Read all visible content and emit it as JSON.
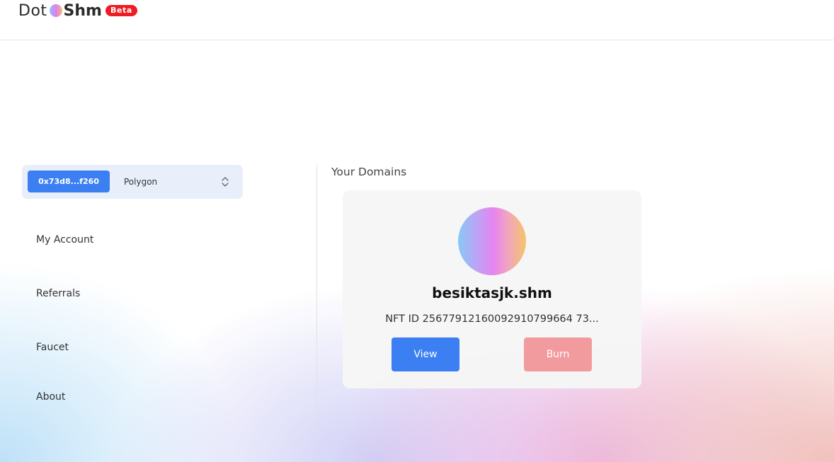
{
  "header": {
    "logo_dot": "Dot",
    "logo_shm": "Shm",
    "beta_badge": "Beta"
  },
  "account": {
    "address": "0x73d8...f260",
    "network": "Polygon"
  },
  "nav": {
    "items": [
      {
        "label": "My Account"
      },
      {
        "label": "Referrals"
      },
      {
        "label": "Faucet"
      },
      {
        "label": "About"
      }
    ]
  },
  "main": {
    "section_title": "Your Domains",
    "domains": [
      {
        "name": "besiktasjk.shm",
        "nft_id": "NFT ID 25677912160092910799664 73...",
        "view_label": "View",
        "burn_label": "Burn"
      }
    ]
  },
  "colors": {
    "primary": "#3b7ff2",
    "burn": "#f29b9f",
    "badge": "#ee1c25"
  },
  "icons": {
    "network_select": "chevron-updown-icon",
    "logo": "gradient-orb-icon",
    "domain_avatar": "gradient-orb-icon"
  }
}
